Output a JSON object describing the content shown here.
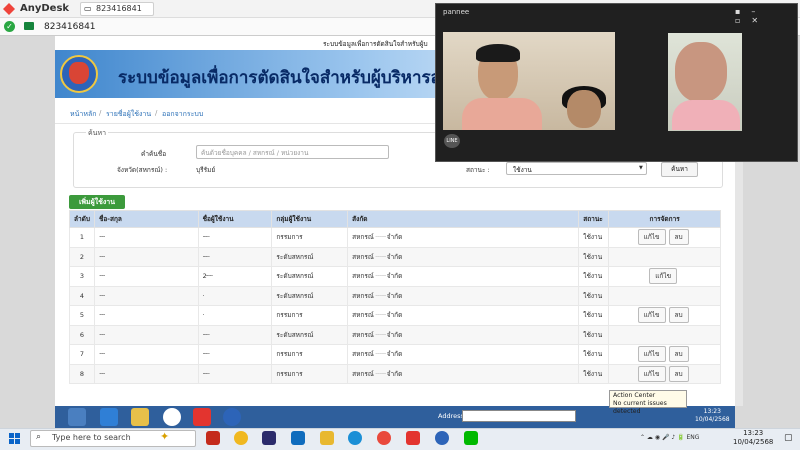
{
  "anydesk": {
    "title": "AnyDesk",
    "tab_id": "823416841",
    "address": "823416841"
  },
  "site": {
    "strip_text": "ระบบข้อมูลเพื่อการตัดสินใจสำหรับผู้บ",
    "banner_title": "ระบบข้อมูลเพื่อการตัดสินใจสำหรับผู้บริหารสหกรณ์"
  },
  "nav": {
    "home": "หน้าหลัก",
    "users": "รายชื่อผู้ใช้งาน",
    "logout": "ออกจากระบบ"
  },
  "search": {
    "legend": "ค้นหา",
    "name_label": "คำค้นชื่อ",
    "name_placeholder": "ค้นด้วยชื่อบุคคล / สหกรณ์ / หน่วยงาน",
    "province_label": "จังหวัด(สหกรณ์) :",
    "province_value": "บุรีรัมย์",
    "status_label": "สถานะ :",
    "status_value": "ใช้งาน",
    "search_button": "ค้นหา"
  },
  "add_button": "เพิ่มผู้ใช้งาน",
  "table": {
    "headers": [
      "ลำดับ",
      "ชื่อ-สกุล",
      "ชื่อผู้ใช้งาน",
      "กลุ่มผู้ใช้งาน",
      "สังกัด",
      "สถานะ",
      "การจัดการ"
    ],
    "rows": [
      {
        "no": "1",
        "name": "·····",
        "user": "······",
        "group": "กรรมการ",
        "org_prefix": "สหกรณ์",
        "org_suffix": "จำกัด",
        "status": "ใช้งาน",
        "edit": "แก้ไข",
        "del": "ลบ"
      },
      {
        "no": "2",
        "name": "·····",
        "user": "······",
        "group": "ระดับสหกรณ์",
        "org_prefix": "สหกรณ์",
        "org_suffix": "จำกัด",
        "status": "ใช้งาน",
        "edit": "",
        "del": ""
      },
      {
        "no": "3",
        "name": "·····",
        "user": "2······",
        "group": "ระดับสหกรณ์",
        "org_prefix": "สหกรณ์",
        "org_suffix": "จำกัด",
        "status": "ใช้งาน",
        "edit": "แก้ไข",
        "del": ""
      },
      {
        "no": "4",
        "name": "·····",
        "user": "·",
        "group": "ระดับสหกรณ์",
        "org_prefix": "สหกรณ์",
        "org_suffix": "จำกัด",
        "status": "ใช้งาน",
        "edit": "",
        "del": ""
      },
      {
        "no": "5",
        "name": "·····",
        "user": "·",
        "group": "กรรมการ",
        "org_prefix": "สหกรณ์",
        "org_suffix": "จำกัด",
        "status": "ใช้งาน",
        "edit": "แก้ไข",
        "del": "ลบ"
      },
      {
        "no": "6",
        "name": "·····",
        "user": "······",
        "group": "ระดับสหกรณ์",
        "org_prefix": "สหกรณ์",
        "org_suffix": "จำกัด",
        "status": "ใช้งาน",
        "edit": "",
        "del": ""
      },
      {
        "no": "7",
        "name": "·····",
        "user": "······",
        "group": "กรรมการ",
        "org_prefix": "สหกรณ์",
        "org_suffix": "จำกัด",
        "status": "ใช้งาน",
        "edit": "แก้ไข",
        "del": "ลบ"
      },
      {
        "no": "8",
        "name": "·····",
        "user": "······",
        "group": "กรรมการ",
        "org_prefix": "สหกรณ์",
        "org_suffix": "จำกัด",
        "status": "ใช้งาน",
        "edit": "แก้ไข",
        "del": "ลบ"
      }
    ]
  },
  "remote_taskbar": {
    "address_label": "Address",
    "time": "13:23",
    "date": "10/04/2568"
  },
  "tooltip": {
    "title": "Action Center",
    "body": "No current issues detected"
  },
  "video": {
    "name": "pannee",
    "badge": "LINE"
  },
  "taskbar": {
    "search_placeholder": "Type here to search",
    "lang": "ENG",
    "time": "13:23",
    "date": "10/04/2568"
  },
  "colors": {
    "banner": "#3f86cd",
    "add_button": "#3c9a3c",
    "table_header": "#c8d9ef",
    "remote_taskbar": "#2f5f9c"
  }
}
